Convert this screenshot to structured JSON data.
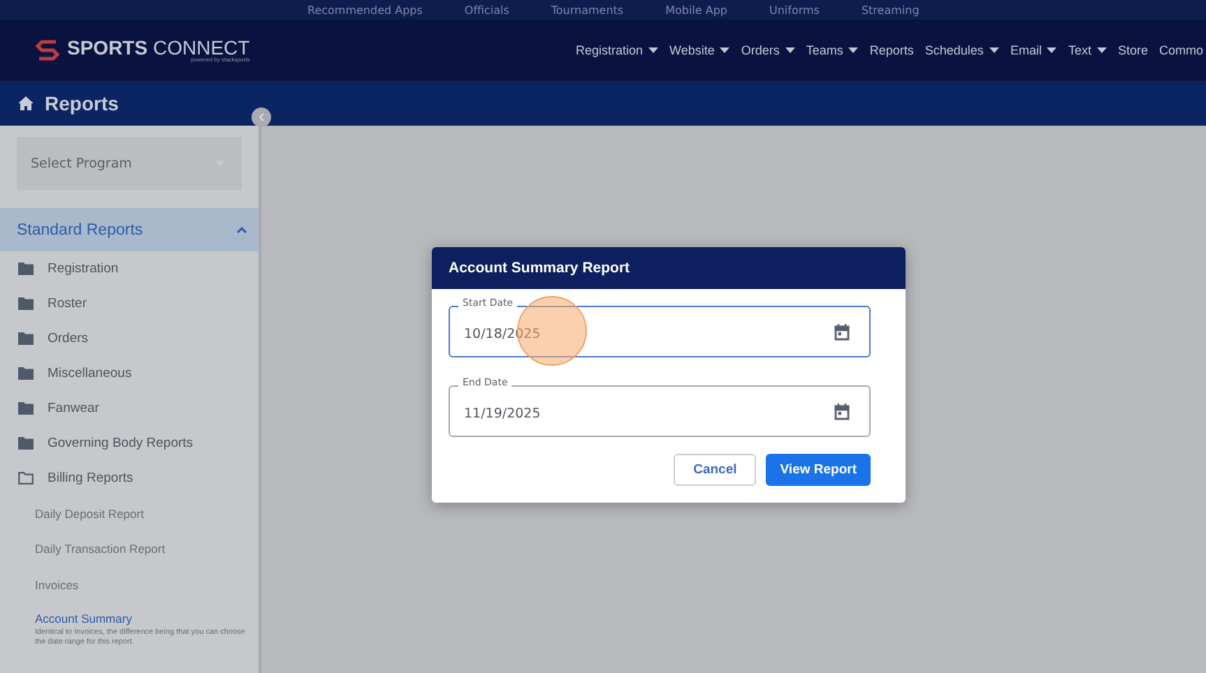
{
  "top_links": [
    "Recommended Apps",
    "Officials",
    "Tournaments",
    "Mobile App",
    "Uniforms",
    "Streaming"
  ],
  "brand": {
    "name": "SPORTS",
    "name_light": "CONNECT",
    "tagline": "powered by stacksports"
  },
  "main_nav": [
    {
      "label": "Registration",
      "dropdown": true
    },
    {
      "label": "Website",
      "dropdown": true
    },
    {
      "label": "Orders",
      "dropdown": true
    },
    {
      "label": "Teams",
      "dropdown": true
    },
    {
      "label": "Reports",
      "dropdown": false
    },
    {
      "label": "Schedules",
      "dropdown": true
    },
    {
      "label": "Email",
      "dropdown": true
    },
    {
      "label": "Text",
      "dropdown": true
    },
    {
      "label": "Store",
      "dropdown": false
    },
    {
      "label": "Commo",
      "dropdown": false
    }
  ],
  "page_title": "Reports",
  "sidebar": {
    "program_select": {
      "placeholder": "Select Program"
    },
    "section": {
      "title": "Standard Reports",
      "expanded": true
    },
    "folders": [
      {
        "label": "Registration",
        "expanded": false
      },
      {
        "label": "Roster",
        "expanded": false
      },
      {
        "label": "Orders",
        "expanded": false
      },
      {
        "label": "Miscellaneous",
        "expanded": false
      },
      {
        "label": "Fanwear",
        "expanded": false
      },
      {
        "label": "Governing Body Reports",
        "expanded": false
      },
      {
        "label": "Billing Reports",
        "expanded": true,
        "children": [
          {
            "label": "Daily Deposit Report",
            "selected": false
          },
          {
            "label": "Daily Transaction Report",
            "selected": false
          },
          {
            "label": "Invoices",
            "selected": false
          },
          {
            "label": "Account Summary",
            "selected": true,
            "description": "Identical to Invoices, the difference being that you can choose the date range for this report."
          }
        ]
      }
    ]
  },
  "modal": {
    "title": "Account Summary Report",
    "fields": [
      {
        "label": "Start Date",
        "value": "10/18/2025",
        "focused": true
      },
      {
        "label": "End Date",
        "value": "11/19/2025",
        "focused": false
      }
    ],
    "buttons": [
      {
        "label": "Cancel",
        "kind": "secondary"
      },
      {
        "label": "View Report",
        "kind": "primary"
      }
    ]
  }
}
